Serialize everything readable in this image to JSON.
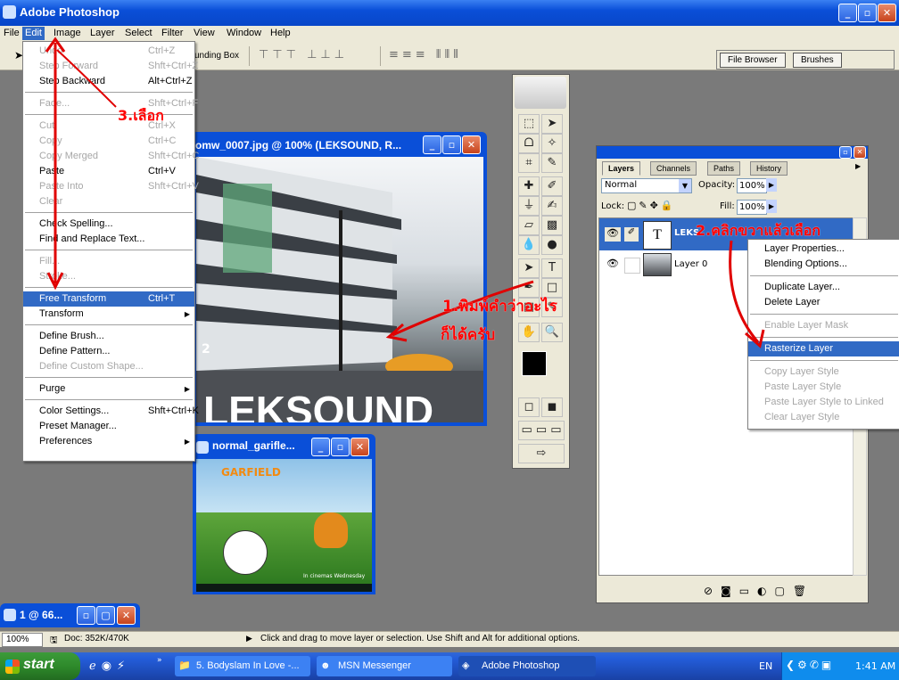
{
  "app": {
    "title": "Adobe Photoshop"
  },
  "menubar": [
    "File",
    "Edit",
    "Image",
    "Layer",
    "Select",
    "Filter",
    "View",
    "Window",
    "Help"
  ],
  "optionsbar": {
    "bounding_box_label": "unding Box",
    "palette_well_tabs": [
      "File Browser",
      "Brushes"
    ]
  },
  "edit_menu": [
    {
      "label": "Undo",
      "shortcut": "Ctrl+Z",
      "disabled": true
    },
    {
      "label": "Step Forward",
      "shortcut": "Shft+Ctrl+Z",
      "disabled": true
    },
    {
      "label": "Step Backward",
      "shortcut": "Alt+Ctrl+Z",
      "disabled": false
    },
    {
      "sep": true
    },
    {
      "label": "Fade...",
      "shortcut": "Shft+Ctrl+F",
      "disabled": true
    },
    {
      "sep": true
    },
    {
      "label": "Cut",
      "shortcut": "Ctrl+X",
      "disabled": true
    },
    {
      "label": "Copy",
      "shortcut": "Ctrl+C",
      "disabled": true
    },
    {
      "label": "Copy Merged",
      "shortcut": "Shft+Ctrl+C",
      "disabled": true
    },
    {
      "label": "Paste",
      "shortcut": "Ctrl+V",
      "disabled": false
    },
    {
      "label": "Paste Into",
      "shortcut": "Shft+Ctrl+V",
      "disabled": true
    },
    {
      "label": "Clear",
      "shortcut": "",
      "disabled": true
    },
    {
      "sep": true
    },
    {
      "label": "Check Spelling...",
      "shortcut": "",
      "disabled": false
    },
    {
      "label": "Find and Replace Text...",
      "shortcut": "",
      "disabled": false
    },
    {
      "sep": true
    },
    {
      "label": "Fill...",
      "shortcut": "",
      "disabled": true
    },
    {
      "label": "Stroke...",
      "shortcut": "",
      "disabled": true
    },
    {
      "sep": true
    },
    {
      "label": "Free Transform",
      "shortcut": "Ctrl+T",
      "disabled": false,
      "highlighted": true
    },
    {
      "label": "Transform",
      "shortcut": "",
      "disabled": false,
      "submenu": true
    },
    {
      "sep": true
    },
    {
      "label": "Define Brush...",
      "shortcut": "",
      "disabled": false
    },
    {
      "label": "Define Pattern...",
      "shortcut": "",
      "disabled": false
    },
    {
      "label": "Define Custom Shape...",
      "shortcut": "",
      "disabled": true
    },
    {
      "sep": true
    },
    {
      "label": "Purge",
      "shortcut": "",
      "disabled": false,
      "submenu": true
    },
    {
      "sep": true
    },
    {
      "label": "Color Settings...",
      "shortcut": "Shft+Ctrl+K",
      "disabled": false
    },
    {
      "label": "Preset Manager...",
      "shortcut": "",
      "disabled": false
    },
    {
      "label": "Preferences",
      "shortcut": "",
      "disabled": false,
      "submenu": true
    }
  ],
  "doc1": {
    "title": "omw_0007.jpg @ 100% (LEKSOUND, R...",
    "overlay_text": "LEKSOUND",
    "level_number": "2"
  },
  "doc2": {
    "title": "normal_garifle...",
    "logo_text": "GARFIELD",
    "footer_text": "In cinemas Wednesday"
  },
  "doc3": {
    "title": "1 @ 66..."
  },
  "layers_palette": {
    "tabs": [
      "Layers",
      "Channels",
      "Paths",
      "History"
    ],
    "blend_mode": "Normal",
    "opacity_label": "Opacity:",
    "opacity": "100%",
    "lock_label": "Lock:",
    "fill_label": "Fill:",
    "fill": "100%",
    "layers": [
      {
        "name": "LEKS",
        "type": "text",
        "selected": true
      },
      {
        "name": "Layer 0",
        "type": "image",
        "selected": false
      }
    ]
  },
  "context_menu": [
    {
      "label": "Layer Properties...",
      "disabled": false
    },
    {
      "label": "Blending Options...",
      "disabled": false
    },
    {
      "sep": true
    },
    {
      "label": "Duplicate Layer...",
      "disabled": false
    },
    {
      "label": "Delete Layer",
      "disabled": false
    },
    {
      "sep": true
    },
    {
      "label": "Enable Layer Mask",
      "disabled": true
    },
    {
      "sep": true
    },
    {
      "label": "Rasterize Layer",
      "disabled": false,
      "highlighted": true
    },
    {
      "sep": true
    },
    {
      "label": "Copy Layer Style",
      "disabled": true
    },
    {
      "label": "Paste Layer Style",
      "disabled": true
    },
    {
      "label": "Paste Layer Style to Linked",
      "disabled": true
    },
    {
      "label": "Clear Layer Style",
      "disabled": true
    }
  ],
  "annotations": {
    "step1_line1": "1.พิมพ์คำว่าอะไร",
    "step1_line2": "ก็ได้ครับ",
    "step2": "2.คลิกขวาแล้วเลือก",
    "step3": "3.เลือก"
  },
  "statusbar": {
    "zoom": "100%",
    "doc_size": "Doc: 352K/470K",
    "hint": "Click and drag to move layer or selection.  Use Shift and Alt for additional options."
  },
  "taskbar": {
    "start": "start",
    "buttons": [
      "5. Bodyslam In Love -...",
      "MSN Messenger",
      "Adobe Photoshop"
    ],
    "lang": "EN",
    "clock": "1:41 AM"
  },
  "colors": {
    "xp_blue": "#0a4fd8",
    "menu_highlight": "#316ac5",
    "annotation_red": "#ff0000",
    "start_green": "#2e8a2b"
  }
}
